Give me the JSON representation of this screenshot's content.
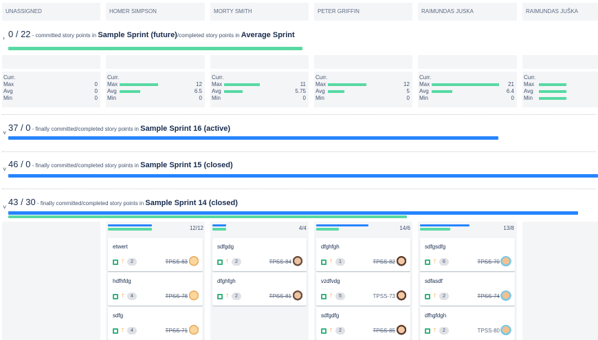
{
  "headers": [
    "UNASSIGNED",
    "HOMER SIMPSON",
    "MORTY SMITH",
    "PETER GRIFFIN",
    "RAIMUNDAS JUSKA",
    "RAIMUNDAS JUŠKA"
  ],
  "future": {
    "numbers": "0 / 22",
    "desc": " - committed story points in ",
    "sprint": "Sample Sprint (future)",
    "mid": "/completed story points in ",
    "avg": "Average Sprint"
  },
  "stat_labels": {
    "curr": "Curr.",
    "max": "Max",
    "avg": "Avg",
    "min": "Min"
  },
  "stats": [
    {
      "max": "0",
      "avg": "0",
      "min": "0"
    },
    {
      "max": "12",
      "avg": "6.5",
      "min": "0"
    },
    {
      "max": "11",
      "avg": "5.75",
      "min": "0"
    },
    {
      "max": "12",
      "avg": "5",
      "min": "0"
    },
    {
      "max": "21",
      "avg": "6.4",
      "min": "0"
    },
    {
      "max": "",
      "avg": "",
      "min": ""
    }
  ],
  "sprints": [
    {
      "numbers": "37 / 0",
      "desc": " - finally committed/completed story points in ",
      "name": "Sample Sprint 16 (active)"
    },
    {
      "numbers": "46 / 0",
      "desc": " - finally committed/completed story points in ",
      "name": "Sample Sprint 15 (closed)"
    },
    {
      "numbers": "43 / 30",
      "desc": " - finally committed/completed story points in ",
      "name": "Sample Sprint 14 (closed)"
    }
  ],
  "lane_counts": [
    "12/12",
    "4/4",
    "14/6",
    "13/8"
  ],
  "cards": {
    "homer": [
      {
        "title": "etwert",
        "points": "2",
        "key": "TPSS-83"
      },
      {
        "title": "hdfhfdg",
        "points": "4",
        "key": "TPSS-78"
      },
      {
        "title": "sdfg",
        "points": "4",
        "key": "TPSS-71"
      }
    ],
    "morty": [
      {
        "title": "sdfgdg",
        "points": "2",
        "key": "TPSS-84"
      },
      {
        "title": "dfghfgh",
        "points": "2",
        "key": "TPSS-81"
      }
    ],
    "peter": [
      {
        "title": "dfghfgh",
        "points": "1",
        "key": "TPSS-82"
      },
      {
        "title": "vzdfvdg",
        "points": "5",
        "key": "TPSS-73"
      },
      {
        "title": "sdfgdfg",
        "points": "2",
        "key": "TPSS-85"
      }
    ],
    "raim": [
      {
        "title": "sdfgsdfg",
        "points": "6",
        "key": "TPSS-70"
      },
      {
        "title": "sdfasdf",
        "points": "2",
        "key": "TPSS-74"
      },
      {
        "title": "dfhgfdgh",
        "points": "2",
        "key": "TPSS-80"
      }
    ]
  },
  "colors": {
    "green": "#57d9a3",
    "blue": "#2684ff",
    "story": "#36b37e",
    "priority": "#ff991f"
  }
}
